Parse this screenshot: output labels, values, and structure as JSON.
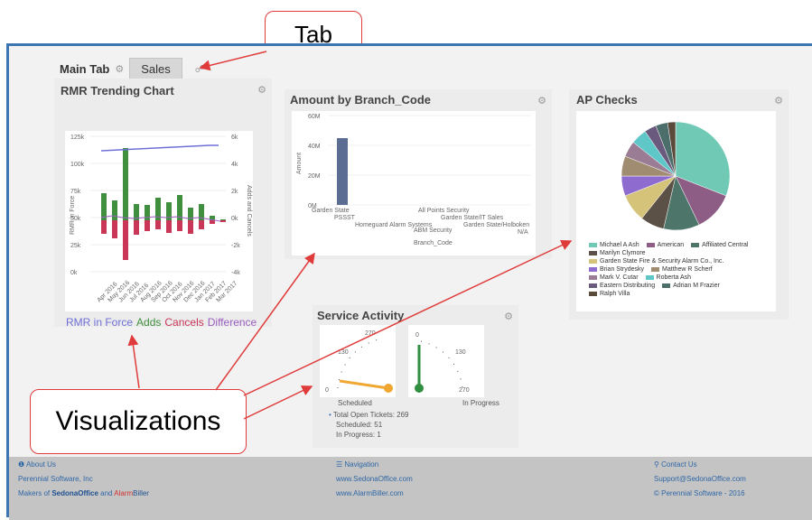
{
  "tabs": {
    "main": "Main Tab",
    "sales": "Sales"
  },
  "annotations": {
    "tab": "Tab",
    "visualizations": "Visualizations"
  },
  "rmr": {
    "title": "RMR Trending Chart",
    "yleft": [
      "125k",
      "100k",
      "75k",
      "50k",
      "25k",
      "0k"
    ],
    "yright": [
      "6k",
      "4k",
      "2k",
      "0k",
      "-2k",
      "-4k"
    ],
    "ylabel_left": "RMR in Force",
    "ylabel_right": "Adds and Cancels",
    "xticks": [
      "Apr 2016",
      "May 2016",
      "Jun 2016",
      "Jul 2016",
      "Aug 2016",
      "Sep 2016",
      "Oct 2016",
      "Nov 2016",
      "Dec 2016",
      "Jan 2017",
      "Feb 2017",
      "Mar 2017"
    ],
    "legend": {
      "rmr": "RMR in Force",
      "adds": "Adds",
      "cancels": "Cancels",
      "difference": "Difference"
    },
    "colors": {
      "rmr": "#6f6fd8",
      "adds": "#3f8f3f",
      "cancels": "#c93658",
      "difference": "#9b5fc0"
    }
  },
  "amount": {
    "title": "Amount by Branch_Code",
    "yticks": [
      "60M",
      "40M",
      "20M",
      "0M"
    ],
    "ylabel": "Amount",
    "xlabel": "Branch_Code",
    "branches": [
      "Garden State",
      "PSSST",
      "Homeguard Alarm Systems",
      "ABM Security",
      "All Points Security",
      "Garden State/IT Sales",
      "Garden State/Holboken",
      "N/A"
    ],
    "color": "#5b6d92"
  },
  "ap": {
    "title": "AP Checks",
    "legend": [
      "Michael A Ash",
      "American",
      "Affiliated Central",
      "Marilyn Clymore",
      "Garden State Fire & Security Alarm Co., Inc.",
      "Brian Strydesky",
      "Matthew R Scherf",
      "Mark V. Cutar",
      "Roberta Ash",
      "Eastern Distributing",
      "Adrian M Frazier",
      "Ralph Villa"
    ],
    "colors": [
      "#6fc9b4",
      "#8e5d86",
      "#4d7569",
      "#5b5146",
      "#d6c37a",
      "#8e6bcf",
      "#a08c70",
      "#9a7d95",
      "#5fc7c8",
      "#6a5a7e",
      "#4b6e6a",
      "#5a4a3c"
    ]
  },
  "service": {
    "title": "Service Activity",
    "gauge1": {
      "ticks": [
        "0",
        "130",
        "270"
      ],
      "label": "Scheduled"
    },
    "gauge2": {
      "ticks": [
        "0",
        "130",
        "270"
      ],
      "label": "In Progress"
    },
    "stats": [
      "Total Open Tickets: 269",
      "Scheduled: 51",
      "In Progress: 1"
    ]
  },
  "footer": {
    "about": "About Us",
    "company": "Perennial Software, Inc",
    "makers_pre": "Makers of ",
    "brand1": "SedonaOffice",
    "and": " and ",
    "brand2a": "Alarm",
    "brand2b": "Biller",
    "nav": "Navigation",
    "nav1": "www.SedonaOffice.com",
    "nav2": "www.AlarmBiller.com",
    "contact": "Contact Us",
    "email": "Support@SedonaOffice.com",
    "copyright": "© Perennial Software - 2016"
  }
}
